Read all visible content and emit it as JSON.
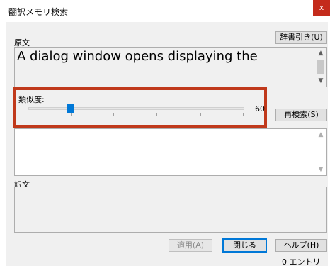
{
  "window": {
    "title": "翻訳メモリ検索",
    "close_glyph": "x"
  },
  "source": {
    "label": "原文",
    "dictionary_button": "辞書引き(U)",
    "text": "A dialog window opens displaying the"
  },
  "similarity": {
    "label": "類似度:",
    "value": "60",
    "research_button": "再検索(S)"
  },
  "translation": {
    "label": "訳文"
  },
  "buttons": {
    "apply": "適用(A)",
    "close": "閉じる",
    "help": "ヘルプ(H)"
  },
  "status": {
    "entries": "0 エントリ"
  },
  "colors": {
    "highlight": "#c0391b",
    "accent": "#0078d7",
    "close": "#c42b1c"
  }
}
